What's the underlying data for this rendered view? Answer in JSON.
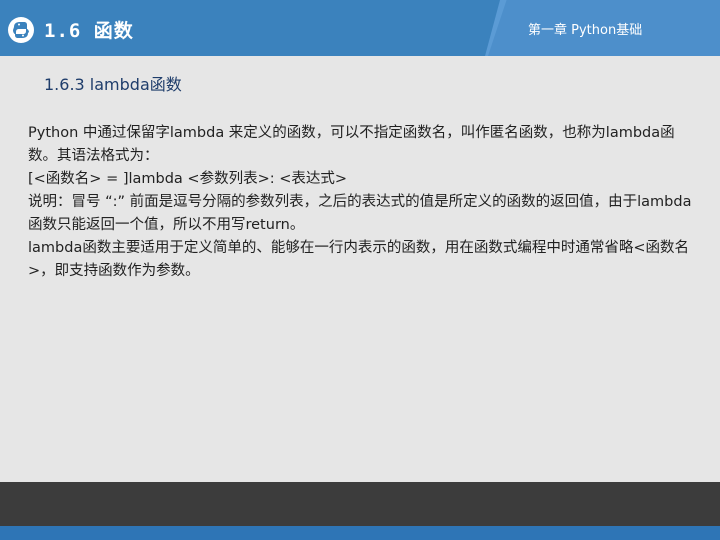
{
  "header": {
    "section_title": "1.6 函数",
    "chapter": "第一章 Python基础"
  },
  "icons": {
    "logo": "python-logo-icon"
  },
  "subtitle": "1.6.3  lambda函数",
  "paragraphs": [
    "Python 中通过保留字lambda 来定义的函数，可以不指定函数名，叫作匿名函数，也称为lambda函数。其语法格式为：",
    "[<函数名> = ]lambda <参数列表>: <表达式>",
    "说明：冒号 “:” 前面是逗号分隔的参数列表，之后的表达式的值是所定义的函数的返回值，由于lambda函数只能返回一个值，所以不用写return。",
    "lambda函数主要适用于定义简单的、能够在一行内表示的函数，用在函数式编程中时通常省略<函数名>，即支持函数作为参数。"
  ],
  "colors": {
    "header_bg": "#3b82bd",
    "footer_bg": "#3c3c3c",
    "accent": "#2e75b6",
    "page_bg": "#e6e6e6"
  }
}
